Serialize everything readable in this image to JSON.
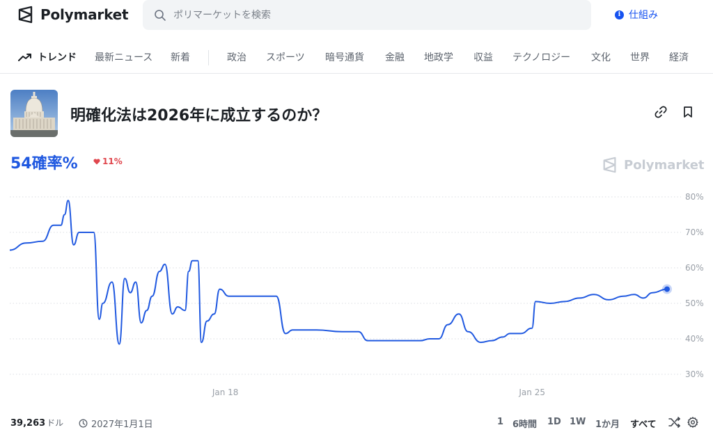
{
  "header": {
    "logo_text": "Polymarket",
    "search_placeholder": "ポリマーケットを検索",
    "how_it_works": "仕組み",
    "accent_color": "#1652f0"
  },
  "nav": {
    "trending": "トレンド",
    "items": [
      "最新ニュース",
      "新着",
      "政治",
      "スポーツ",
      "暗号通貨",
      "金融",
      "地政学",
      "収益",
      "テクノロジー",
      "文化",
      "世界",
      "経済"
    ]
  },
  "market": {
    "image": "capitol-building",
    "title": "明確化法は2026年に成立するのか？",
    "probability": "54確率%",
    "change": "11%",
    "change_direction": "down",
    "watermark": "Polymarket",
    "volume": "39,263",
    "volume_unit": "ドル",
    "end_date": "2027年1月1日"
  },
  "chart_data": {
    "type": "line",
    "y_unit": "%",
    "y_ticks": [
      "80%",
      "70%",
      "60%",
      "50%",
      "40%",
      "30%"
    ],
    "x_ticks": [
      "Jan 18",
      "Jan 25"
    ],
    "ylim": [
      30,
      80
    ],
    "x_start": "2026-01-13",
    "x_end": "2026-01-28",
    "line_color": "#1f58e0",
    "grid": true,
    "series": [
      {
        "x": [
          "2026-01-13",
          "2026-01-13T09",
          "2026-01-13T18",
          "2026-01-14",
          "2026-01-14T04",
          "2026-01-14T06",
          "2026-01-14T08",
          "2026-01-14T11",
          "2026-01-14T14",
          "2026-01-14T22",
          "2026-01-15T01",
          "2026-01-15T03",
          "2026-01-15T08",
          "2026-01-15T12",
          "2026-01-15T15",
          "2026-01-15T18",
          "2026-01-15T21",
          "2026-01-16",
          "2026-01-16T03",
          "2026-01-16T06",
          "2026-01-16T10",
          "2026-01-16T13",
          "2026-01-16T17",
          "2026-01-16T20",
          "2026-01-17",
          "2026-01-17T02",
          "2026-01-17T04",
          "2026-01-17T07",
          "2026-01-17T09",
          "2026-01-17T12",
          "2026-01-17T16",
          "2026-01-17T19",
          "2026-01-18",
          "2026-01-18T06",
          "2026-01-18T13",
          "2026-01-19T02",
          "2026-01-19T07",
          "2026-01-19T11",
          "2026-01-19T16",
          "2026-01-20",
          "2026-01-20T14",
          "2026-01-20T23",
          "2026-01-21T04",
          "2026-01-21T13",
          "2026-01-22",
          "2026-01-22T09",
          "2026-01-22T14",
          "2026-01-22T19",
          "2026-01-23",
          "2026-01-23T06",
          "2026-01-23T11",
          "2026-01-23T18",
          "2026-01-24",
          "2026-01-24T06",
          "2026-01-24T10",
          "2026-01-24T16",
          "2026-01-24T22",
          "2026-01-25",
          "2026-01-25T08",
          "2026-01-25T16",
          "2026-01-26",
          "2026-01-26T08",
          "2026-01-26T16",
          "2026-01-27",
          "2026-01-27T06",
          "2026-01-27T11",
          "2026-01-27T16",
          "2026-01-28"
        ],
        "y": [
          65,
          67,
          67.5,
          72,
          72,
          75,
          79,
          66.5,
          70,
          70,
          45.5,
          50,
          56,
          38.5,
          57,
          53,
          56,
          44.5,
          48,
          52,
          59,
          61,
          47,
          49,
          48,
          59,
          62,
          62,
          39,
          45,
          47,
          54,
          52,
          52,
          52,
          52,
          41.5,
          42.5,
          42.5,
          42.5,
          42,
          42,
          39.5,
          39.5,
          39.5,
          39.5,
          40,
          40,
          44,
          47,
          42,
          39,
          39.5,
          40.5,
          41.5,
          41.5,
          43,
          50.5,
          50,
          50.5,
          51.5,
          52.5,
          51,
          52,
          52.5,
          51.5,
          53,
          54
        ]
      }
    ]
  },
  "ranges": [
    "1",
    "6時間",
    "1D",
    "1W",
    "1か月",
    "すべて"
  ],
  "active_range": "すべて"
}
